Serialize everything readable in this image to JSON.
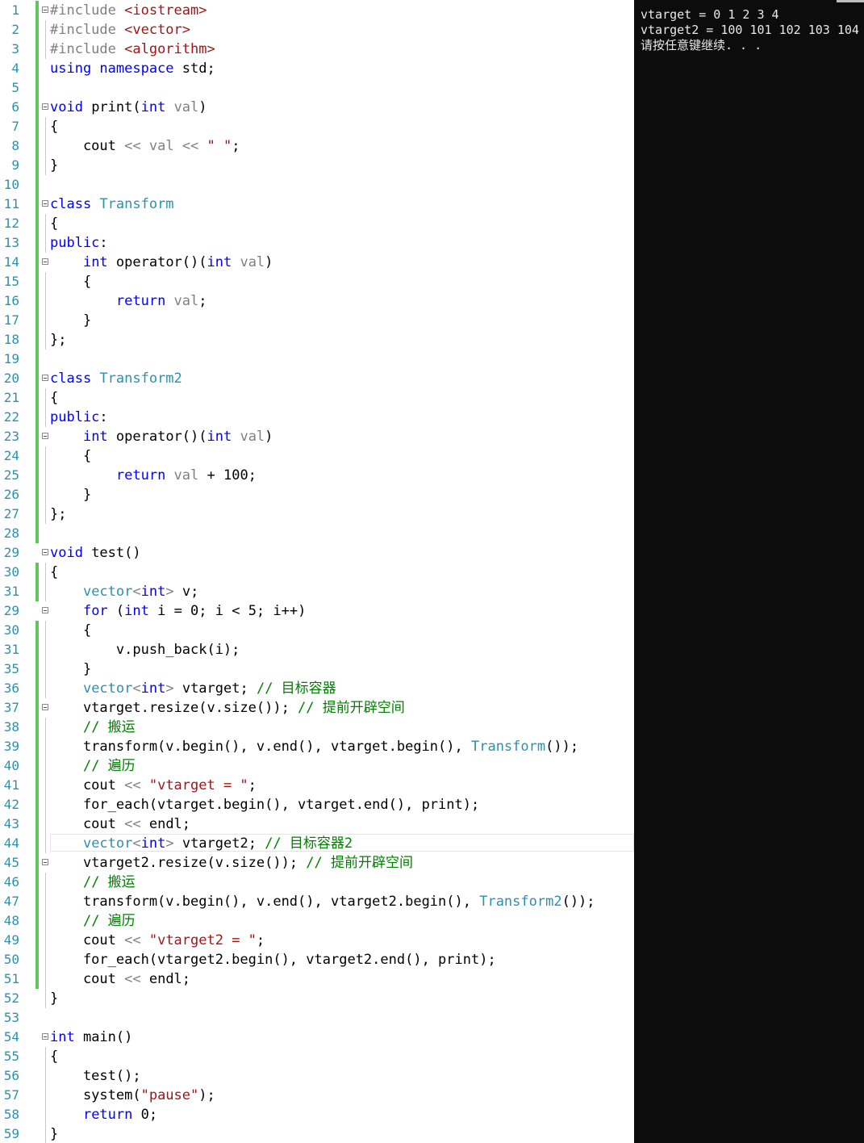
{
  "editor": {
    "lines": [
      {
        "n": "1",
        "f": true,
        "c": true,
        "g": false,
        "t": [
          [
            "pr",
            "#include "
          ],
          [
            "str",
            "<iostream>"
          ]
        ]
      },
      {
        "n": "2",
        "f": false,
        "c": true,
        "g": true,
        "t": [
          [
            "pr",
            "#include "
          ],
          [
            "str",
            "<vector>"
          ]
        ]
      },
      {
        "n": "3",
        "f": false,
        "c": true,
        "g": true,
        "t": [
          [
            "pr",
            "#include "
          ],
          [
            "str",
            "<algorithm>"
          ]
        ]
      },
      {
        "n": "4",
        "f": false,
        "c": true,
        "g": false,
        "t": [
          [
            "kw",
            "using namespace "
          ],
          [
            "",
            "std;"
          ]
        ]
      },
      {
        "n": "5",
        "f": false,
        "c": true,
        "g": false,
        "t": []
      },
      {
        "n": "6",
        "f": true,
        "c": true,
        "g": false,
        "t": [
          [
            "kw",
            "void "
          ],
          [
            "",
            "print("
          ],
          [
            "kw",
            "int "
          ],
          [
            "prm",
            "val"
          ],
          [
            "",
            ")"
          ]
        ]
      },
      {
        "n": "7",
        "f": false,
        "c": true,
        "g": true,
        "t": [
          [
            "",
            "{"
          ]
        ]
      },
      {
        "n": "8",
        "f": false,
        "c": true,
        "g": true,
        "t": [
          [
            "",
            "    cout "
          ],
          [
            "pr",
            "<< "
          ],
          [
            "prm",
            "val "
          ],
          [
            "pr",
            "<< "
          ],
          [
            "str",
            "\" \""
          ],
          [
            "",
            ";"
          ]
        ]
      },
      {
        "n": "9",
        "f": false,
        "c": true,
        "g": true,
        "t": [
          [
            "",
            "}"
          ]
        ]
      },
      {
        "n": "10",
        "f": false,
        "c": true,
        "g": false,
        "t": []
      },
      {
        "n": "11",
        "f": true,
        "c": true,
        "g": false,
        "t": [
          [
            "kw",
            "class "
          ],
          [
            "ty",
            "Transform"
          ]
        ]
      },
      {
        "n": "12",
        "f": false,
        "c": true,
        "g": true,
        "t": [
          [
            "",
            "{"
          ]
        ]
      },
      {
        "n": "13",
        "f": false,
        "c": true,
        "g": true,
        "t": [
          [
            "kw",
            "public"
          ],
          [
            "",
            ":"
          ]
        ]
      },
      {
        "n": "14",
        "f": true,
        "c": true,
        "g": false,
        "t": [
          [
            "",
            "    "
          ],
          [
            "kw",
            "int "
          ],
          [
            "",
            "operator()("
          ],
          [
            "kw",
            "int "
          ],
          [
            "prm",
            "val"
          ],
          [
            "",
            ")"
          ]
        ]
      },
      {
        "n": "15",
        "f": false,
        "c": true,
        "g": true,
        "t": [
          [
            "",
            "    {"
          ]
        ]
      },
      {
        "n": "16",
        "f": false,
        "c": true,
        "g": true,
        "t": [
          [
            "",
            "        "
          ],
          [
            "kw",
            "return "
          ],
          [
            "prm",
            "val"
          ],
          [
            "",
            ";"
          ]
        ]
      },
      {
        "n": "17",
        "f": false,
        "c": true,
        "g": true,
        "t": [
          [
            "",
            "    }"
          ]
        ]
      },
      {
        "n": "18",
        "f": false,
        "c": true,
        "g": true,
        "t": [
          [
            "",
            "};"
          ]
        ]
      },
      {
        "n": "19",
        "f": false,
        "c": true,
        "g": false,
        "t": []
      },
      {
        "n": "20",
        "f": true,
        "c": true,
        "g": false,
        "t": [
          [
            "kw",
            "class "
          ],
          [
            "ty",
            "Transform2"
          ]
        ]
      },
      {
        "n": "21",
        "f": false,
        "c": true,
        "g": true,
        "t": [
          [
            "",
            "{"
          ]
        ]
      },
      {
        "n": "22",
        "f": false,
        "c": true,
        "g": true,
        "t": [
          [
            "kw",
            "public"
          ],
          [
            "",
            ":"
          ]
        ]
      },
      {
        "n": "23",
        "f": true,
        "c": true,
        "g": false,
        "t": [
          [
            "",
            "    "
          ],
          [
            "kw",
            "int "
          ],
          [
            "",
            "operator()("
          ],
          [
            "kw",
            "int "
          ],
          [
            "prm",
            "val"
          ],
          [
            "",
            ")"
          ]
        ]
      },
      {
        "n": "24",
        "f": false,
        "c": true,
        "g": true,
        "t": [
          [
            "",
            "    {"
          ]
        ]
      },
      {
        "n": "25",
        "f": false,
        "c": true,
        "g": true,
        "t": [
          [
            "",
            "        "
          ],
          [
            "kw",
            "return "
          ],
          [
            "prm",
            "val "
          ],
          [
            "",
            "+ 100;"
          ]
        ]
      },
      {
        "n": "26",
        "f": false,
        "c": true,
        "g": true,
        "t": [
          [
            "",
            "    }"
          ]
        ]
      },
      {
        "n": "27",
        "f": false,
        "c": true,
        "g": true,
        "t": [
          [
            "",
            "};"
          ]
        ]
      },
      {
        "n": "28",
        "f": false,
        "c": true,
        "g": false,
        "t": []
      },
      {
        "n": "29",
        "f": true,
        "c": false,
        "g": false,
        "t": [
          [
            "kw",
            "void "
          ],
          [
            "",
            "test()"
          ]
        ]
      },
      {
        "n": "30",
        "f": false,
        "c": true,
        "g": true,
        "t": [
          [
            "",
            "{"
          ]
        ]
      },
      {
        "n": "31",
        "f": false,
        "c": true,
        "g": true,
        "t": [
          [
            "",
            "    "
          ],
          [
            "ty",
            "vector"
          ],
          [
            "pr",
            "<"
          ],
          [
            "kw",
            "int"
          ],
          [
            "pr",
            "> "
          ],
          [
            "",
            "v;"
          ]
        ]
      },
      {
        "n": "29",
        "f": true,
        "c": false,
        "g": false,
        "t": [
          [
            "",
            "    "
          ],
          [
            "kw",
            "for "
          ],
          [
            "",
            "("
          ],
          [
            "kw",
            "int "
          ],
          [
            "",
            "i = 0; i < 5; i++)"
          ]
        ]
      },
      {
        "n": "30",
        "f": false,
        "c": true,
        "g": true,
        "t": [
          [
            "",
            "    {"
          ]
        ]
      },
      {
        "n": "31",
        "f": false,
        "c": true,
        "g": true,
        "t": [
          [
            "",
            "        v.push_back(i);"
          ]
        ]
      },
      {
        "n": "35",
        "f": false,
        "c": true,
        "g": true,
        "t": [
          [
            "",
            "    }"
          ]
        ]
      },
      {
        "n": "36",
        "f": false,
        "c": true,
        "g": true,
        "t": [
          [
            "",
            "    "
          ],
          [
            "ty",
            "vector"
          ],
          [
            "pr",
            "<"
          ],
          [
            "kw",
            "int"
          ],
          [
            "pr",
            "> "
          ],
          [
            "",
            "vtarget; "
          ],
          [
            "cm",
            "// 目标容器"
          ]
        ]
      },
      {
        "n": "37",
        "f": true,
        "c": true,
        "g": false,
        "t": [
          [
            "",
            "    vtarget.resize(v.size()); "
          ],
          [
            "cm",
            "// 提前开辟空间"
          ]
        ]
      },
      {
        "n": "38",
        "f": false,
        "c": true,
        "g": true,
        "t": [
          [
            "",
            "    "
          ],
          [
            "cm",
            "// 搬运"
          ]
        ]
      },
      {
        "n": "39",
        "f": false,
        "c": true,
        "g": true,
        "t": [
          [
            "",
            "    transform(v.begin(), v.end(), vtarget.begin(), "
          ],
          [
            "ty",
            "Transform"
          ],
          [
            "",
            "());"
          ]
        ]
      },
      {
        "n": "40",
        "f": false,
        "c": true,
        "g": true,
        "t": [
          [
            "",
            "    "
          ],
          [
            "cm",
            "// 遍历"
          ]
        ]
      },
      {
        "n": "41",
        "f": false,
        "c": true,
        "g": true,
        "t": [
          [
            "",
            "    cout "
          ],
          [
            "pr",
            "<< "
          ],
          [
            "str",
            "\"vtarget = \""
          ],
          [
            "",
            ";"
          ]
        ]
      },
      {
        "n": "42",
        "f": false,
        "c": true,
        "g": true,
        "t": [
          [
            "",
            "    for_each(vtarget.begin(), vtarget.end(), print);"
          ]
        ]
      },
      {
        "n": "43",
        "f": false,
        "c": true,
        "g": true,
        "t": [
          [
            "",
            "    cout "
          ],
          [
            "pr",
            "<< "
          ],
          [
            "",
            "endl;"
          ]
        ]
      },
      {
        "n": "44",
        "f": false,
        "c": true,
        "g": true,
        "cur": true,
        "t": [
          [
            "",
            "    "
          ],
          [
            "ty",
            "vector"
          ],
          [
            "pr",
            "<"
          ],
          [
            "kw",
            "int"
          ],
          [
            "pr",
            "> "
          ],
          [
            "",
            "vtarget2; "
          ],
          [
            "cm",
            "// 目标容器2"
          ]
        ]
      },
      {
        "n": "45",
        "f": true,
        "c": true,
        "g": false,
        "t": [
          [
            "",
            "    vtarget2.resize(v.size()); "
          ],
          [
            "cm",
            "// 提前开辟空间"
          ]
        ]
      },
      {
        "n": "46",
        "f": false,
        "c": true,
        "g": true,
        "t": [
          [
            "",
            "    "
          ],
          [
            "cm",
            "// 搬运"
          ]
        ]
      },
      {
        "n": "47",
        "f": false,
        "c": true,
        "g": true,
        "t": [
          [
            "",
            "    transform(v.begin(), v.end(), vtarget2.begin(), "
          ],
          [
            "ty",
            "Transform2"
          ],
          [
            "",
            "());"
          ]
        ]
      },
      {
        "n": "48",
        "f": false,
        "c": true,
        "g": true,
        "t": [
          [
            "",
            "    "
          ],
          [
            "cm",
            "// 遍历"
          ]
        ]
      },
      {
        "n": "49",
        "f": false,
        "c": true,
        "g": true,
        "t": [
          [
            "",
            "    cout "
          ],
          [
            "pr",
            "<< "
          ],
          [
            "str",
            "\"vtarget2 = \""
          ],
          [
            "",
            ";"
          ]
        ]
      },
      {
        "n": "50",
        "f": false,
        "c": true,
        "g": true,
        "t": [
          [
            "",
            "    for_each(vtarget2.begin(), vtarget2.end(), print);"
          ]
        ]
      },
      {
        "n": "51",
        "f": false,
        "c": true,
        "g": true,
        "t": [
          [
            "",
            "    cout "
          ],
          [
            "pr",
            "<< "
          ],
          [
            "",
            "endl;"
          ]
        ]
      },
      {
        "n": "52",
        "f": false,
        "c": false,
        "g": true,
        "t": [
          [
            "",
            "}"
          ]
        ]
      },
      {
        "n": "53",
        "f": false,
        "c": false,
        "g": false,
        "t": []
      },
      {
        "n": "54",
        "f": true,
        "c": false,
        "g": false,
        "t": [
          [
            "kw",
            "int "
          ],
          [
            "",
            "main()"
          ]
        ]
      },
      {
        "n": "55",
        "f": false,
        "c": false,
        "g": true,
        "t": [
          [
            "",
            "{"
          ]
        ]
      },
      {
        "n": "56",
        "f": false,
        "c": false,
        "g": true,
        "t": [
          [
            "",
            "    test();"
          ]
        ]
      },
      {
        "n": "57",
        "f": false,
        "c": false,
        "g": true,
        "t": [
          [
            "",
            "    system("
          ],
          [
            "str",
            "\"pause\""
          ],
          [
            "",
            ");"
          ]
        ]
      },
      {
        "n": "58",
        "f": false,
        "c": false,
        "g": true,
        "t": [
          [
            "",
            "    "
          ],
          [
            "kw",
            "return "
          ],
          [
            "",
            "0;"
          ]
        ]
      },
      {
        "n": "59",
        "f": false,
        "c": false,
        "g": true,
        "t": [
          [
            "",
            "}"
          ]
        ]
      }
    ]
  },
  "console": {
    "lines": [
      "vtarget = 0 1 2 3 4",
      "vtarget2 = 100 101 102 103 104",
      "请按任意键继续. . ."
    ]
  }
}
